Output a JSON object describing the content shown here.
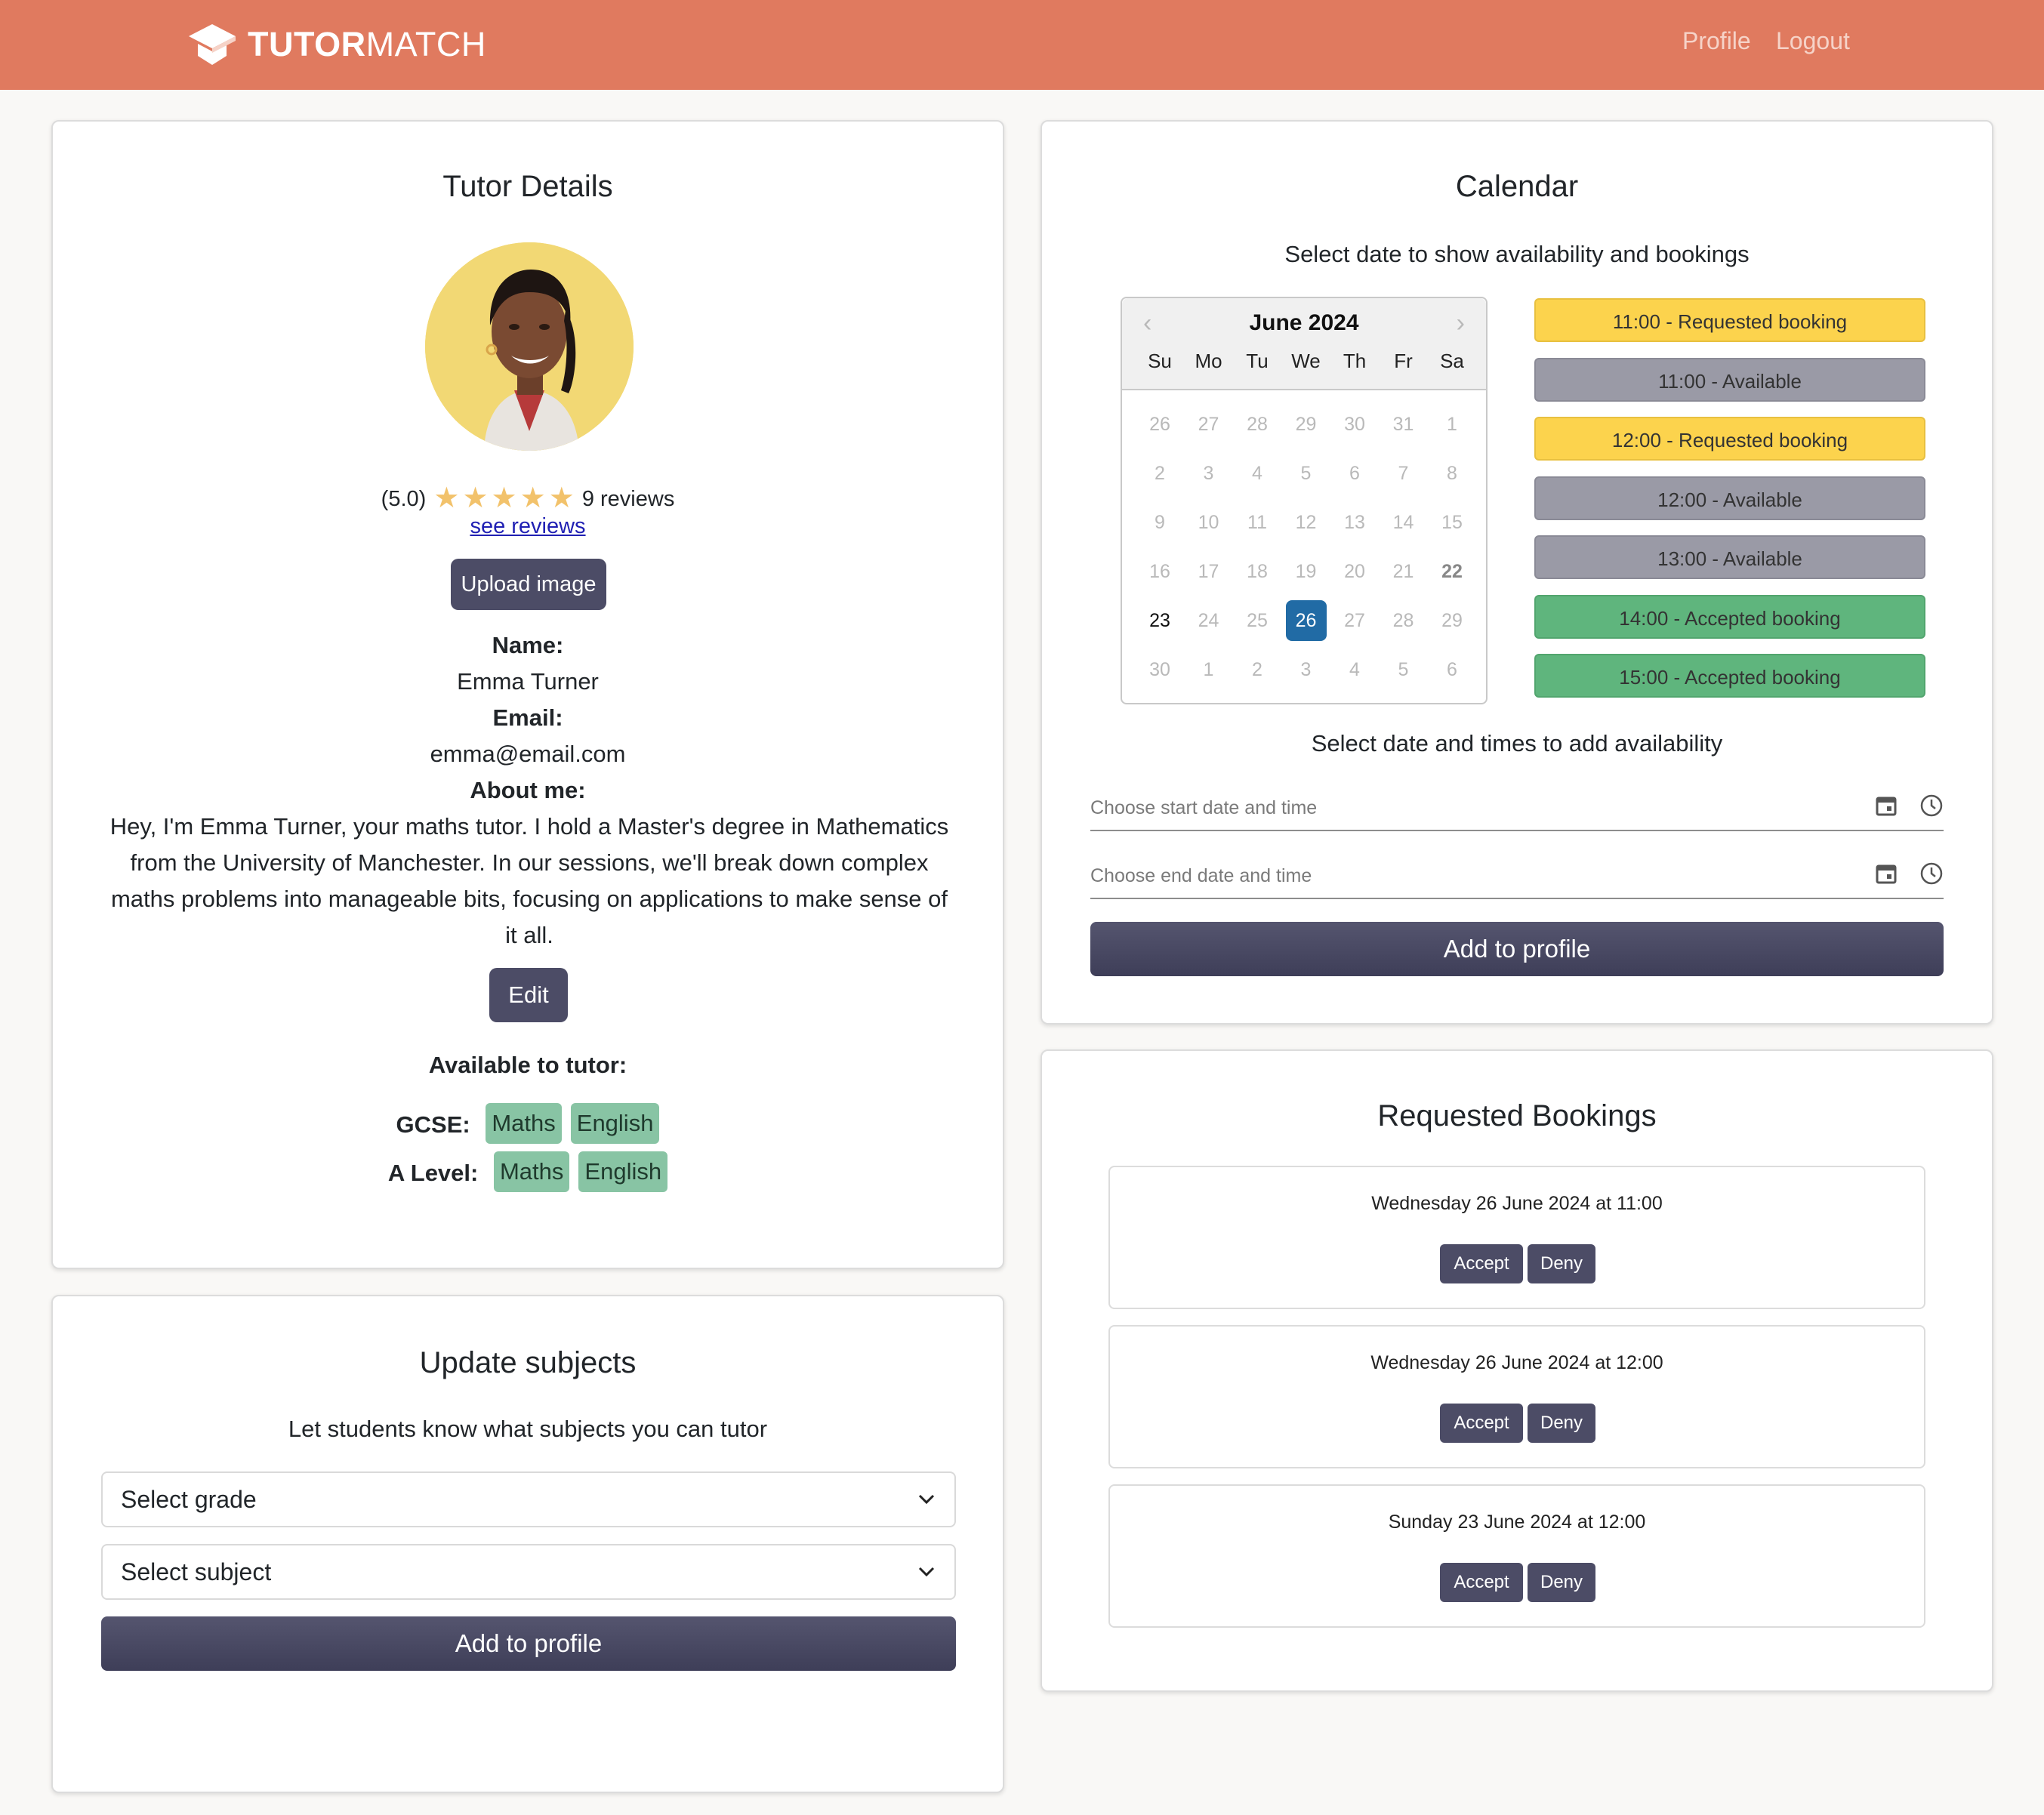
{
  "nav": {
    "brand_bold": "TUTOR",
    "brand_light": "MATCH",
    "links": [
      "Profile",
      "Logout"
    ]
  },
  "tutor": {
    "title": "Tutor Details",
    "rating_value": "(5.0)",
    "rating_stars": 5,
    "reviews_count": "9 reviews",
    "see_reviews": "see reviews",
    "upload_button": "Upload image",
    "name_label": "Name:",
    "name": "Emma Turner",
    "email_label": "Email:",
    "email": "emma@email.com",
    "about_label": "About me:",
    "about": "Hey, I'm Emma Turner, your maths tutor. I hold a Master's degree in Mathematics from the University of Manchester. In our sessions, we'll break down complex maths problems into manageable bits, focusing on applications to make sense of it all.",
    "edit_button": "Edit",
    "available_label": "Available to tutor:",
    "levels": [
      {
        "label": "GCSE:",
        "subjects": [
          "Maths",
          "English"
        ]
      },
      {
        "label": "A Level:",
        "subjects": [
          "Maths",
          "English"
        ]
      }
    ]
  },
  "subjects": {
    "title": "Update subjects",
    "subtitle": "Let students know what subjects you can tutor",
    "grade_select": "Select grade",
    "subject_select": "Select subject",
    "add_button": "Add to profile"
  },
  "calendar": {
    "title": "Calendar",
    "subtitle": "Select date to show availability and bookings",
    "month": "June 2024",
    "weekdays": [
      "Su",
      "Mo",
      "Tu",
      "We",
      "Th",
      "Fr",
      "Sa"
    ],
    "weeks": [
      [
        "26",
        "27",
        "28",
        "29",
        "30",
        "31",
        "1"
      ],
      [
        "2",
        "3",
        "4",
        "5",
        "6",
        "7",
        "8"
      ],
      [
        "9",
        "10",
        "11",
        "12",
        "13",
        "14",
        "15"
      ],
      [
        "16",
        "17",
        "18",
        "19",
        "20",
        "21",
        "22"
      ],
      [
        "23",
        "24",
        "25",
        "26",
        "27",
        "28",
        "29"
      ],
      [
        "30",
        "1",
        "2",
        "3",
        "4",
        "5",
        "6"
      ]
    ],
    "today": "23",
    "selected": "26",
    "highlighted": "22",
    "slots": [
      {
        "label": "11:00 - Requested booking",
        "status": "requested"
      },
      {
        "label": "11:00 - Available",
        "status": "available"
      },
      {
        "label": "12:00 - Requested booking",
        "status": "requested"
      },
      {
        "label": "12:00 - Available",
        "status": "available"
      },
      {
        "label": "13:00 - Available",
        "status": "available"
      },
      {
        "label": "14:00 - Accepted booking",
        "status": "accepted"
      },
      {
        "label": "15:00 - Accepted booking",
        "status": "accepted"
      }
    ],
    "add_subtitle": "Select date and times to add availability",
    "start_placeholder": "Choose start date and time",
    "end_placeholder": "Choose end date and time",
    "add_button": "Add to profile"
  },
  "bookings": {
    "title": "Requested Bookings",
    "items": [
      {
        "text": "Wednesday 26 June 2024 at 11:00",
        "accept": "Accept",
        "deny": "Deny"
      },
      {
        "text": "Wednesday 26 June 2024 at 12:00",
        "accept": "Accept",
        "deny": "Deny"
      },
      {
        "text": "Sunday 23 June 2024 at 12:00",
        "accept": "Accept",
        "deny": "Deny"
      }
    ]
  },
  "colors": {
    "navbar": "#e07a5f",
    "button": "#4c4c66",
    "tag": "#88c4a4",
    "requested": "#fcd34d",
    "available": "#9a9aa6",
    "accepted": "#5fb57d",
    "selected_day": "#216ba5"
  }
}
